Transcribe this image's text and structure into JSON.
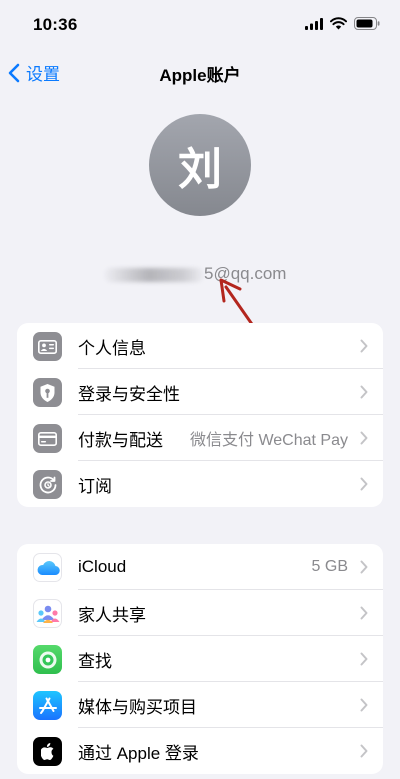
{
  "status_bar": {
    "time": "10:36"
  },
  "nav": {
    "back_label": "设置",
    "title": "Apple账户"
  },
  "profile": {
    "avatar_initial": "刘",
    "email_visible": "5@qq.com"
  },
  "group1": [
    {
      "label": "个人信息",
      "value": "",
      "icon": "person-card-icon"
    },
    {
      "label": "登录与安全性",
      "value": "",
      "icon": "key-shield-icon"
    },
    {
      "label": "付款与配送",
      "value": "微信支付 WeChat Pay",
      "icon": "credit-card-icon"
    },
    {
      "label": "订阅",
      "value": "",
      "icon": "subscription-icon"
    }
  ],
  "group2": [
    {
      "label": "iCloud",
      "value": "5 GB",
      "icon": "icloud-icon"
    },
    {
      "label": "家人共享",
      "value": "",
      "icon": "family-sharing-icon"
    },
    {
      "label": "查找",
      "value": "",
      "icon": "find-my-icon"
    },
    {
      "label": "媒体与购买项目",
      "value": "",
      "icon": "app-store-icon"
    },
    {
      "label": "通过 Apple 登录",
      "value": "",
      "icon": "apple-logo-icon"
    }
  ],
  "colors": {
    "accent": "#0a7aff",
    "background": "#f2f2f7",
    "annotation": "#b3261e"
  }
}
